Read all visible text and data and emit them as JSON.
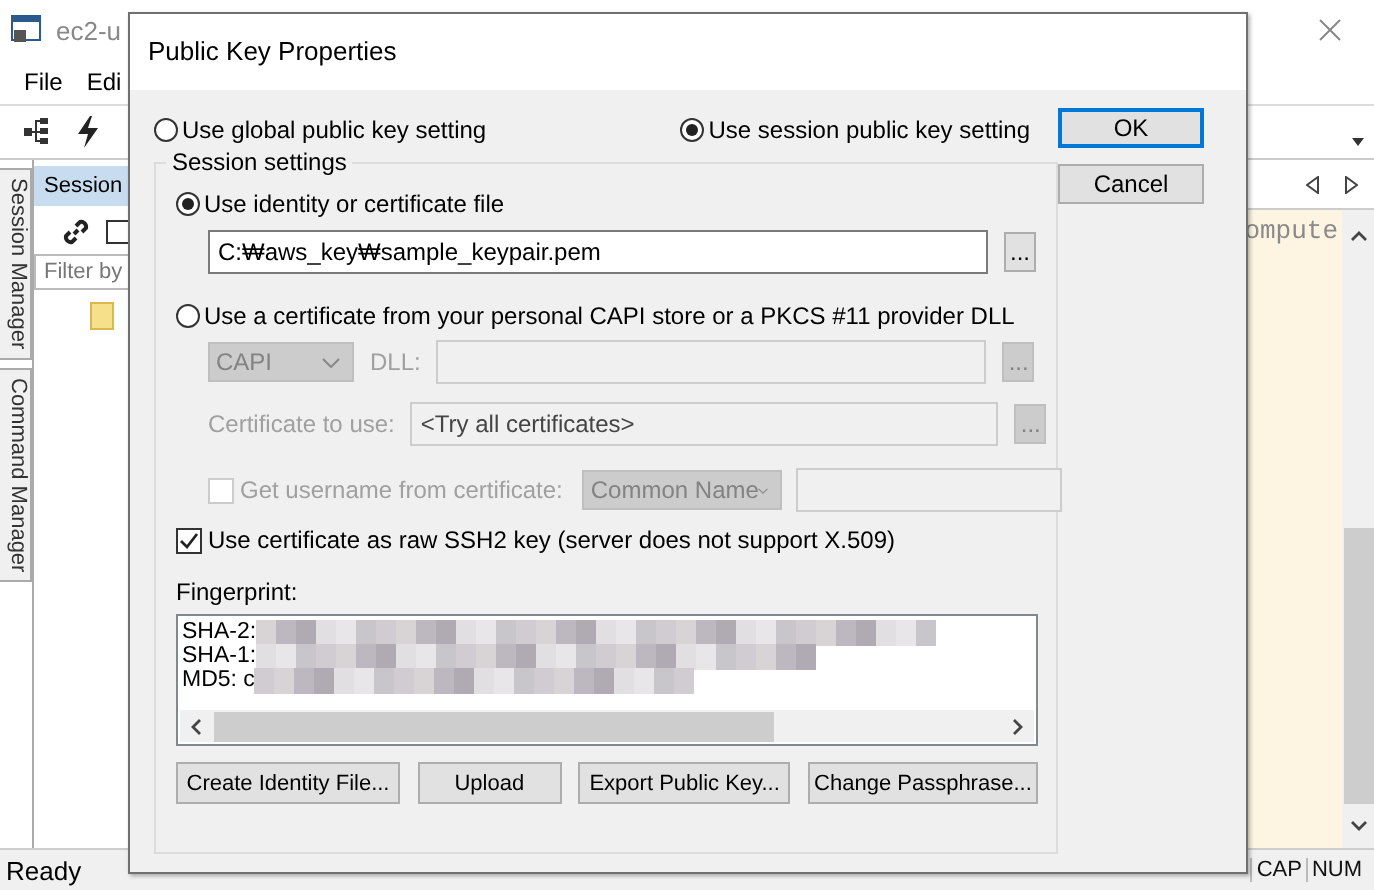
{
  "app": {
    "title": "ec2-u",
    "menu": [
      "File",
      "Edi"
    ],
    "session_panel": {
      "header": "Session",
      "filter_placeholder": "Filter by"
    },
    "side_tabs": [
      "Session Manager",
      "Command Manager"
    ],
    "terminal_text": "ompute",
    "status_bar": {
      "ready": "Ready",
      "indicators": [
        "CAP",
        "NUM"
      ]
    }
  },
  "dialog": {
    "title": "Public Key Properties",
    "scope_options": [
      {
        "label": "Use global public key setting",
        "selected": false
      },
      {
        "label": "Use session public key setting",
        "selected": true
      }
    ],
    "buttons": [
      {
        "label": "OK",
        "default": true
      },
      {
        "label": "Cancel",
        "default": false
      }
    ],
    "session_settings": {
      "legend": "Session settings",
      "source_options": [
        {
          "label": "Use identity or certificate file",
          "selected": true
        },
        {
          "label": "Use a certificate from your personal CAPI store or a PKCS #11 provider DLL",
          "selected": false
        }
      ],
      "identity_file": "C:₩aws_key₩sample_keypair.pem",
      "identity_browse": "...",
      "capi": {
        "disabled": true,
        "provider": "CAPI",
        "dll_label": "DLL:",
        "dll_browse": "...",
        "certificate_label": "Certificate to use:",
        "certificate": "<Try all certificates>",
        "certificate_browse": "...",
        "username_label": "Get username from certificate:",
        "username_checked": false,
        "username_field": "Common Name"
      },
      "raw_ssh2": {
        "label": "Use certificate as raw SSH2 key (server does not support X.509)",
        "checked": true
      },
      "fingerprint": {
        "label": "Fingerprint:",
        "lines": [
          "SHA-2:",
          "SHA-1:",
          "MD5: c"
        ]
      },
      "actions": [
        "Create Identity File...",
        "Upload",
        "Export Public Key...",
        "Change Passphrase..."
      ]
    }
  }
}
